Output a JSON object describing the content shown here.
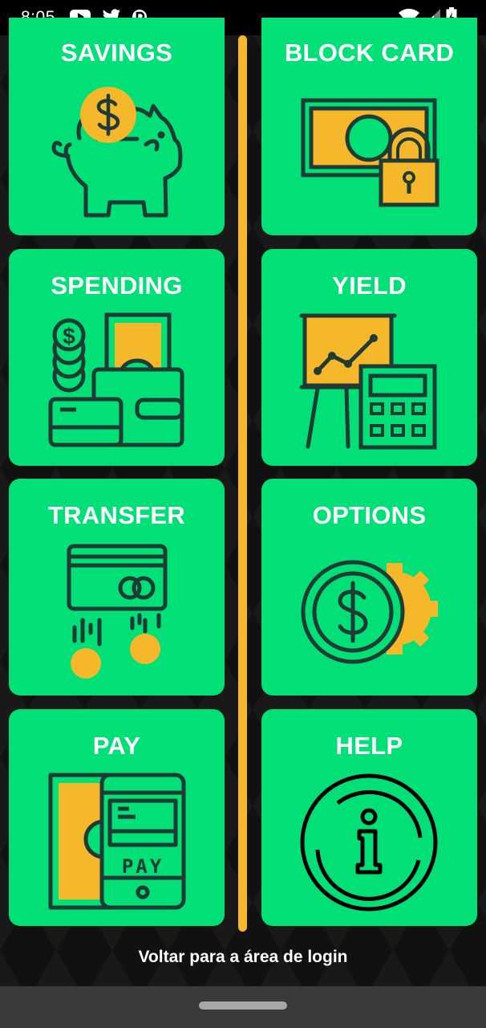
{
  "status_bar": {
    "time": "8:05",
    "icons": [
      "youtube-icon",
      "twitter-icon",
      "p-app-icon",
      "wifi-icon",
      "signal-icon",
      "battery-icon"
    ]
  },
  "colors": {
    "tile": "#00e077",
    "accent": "#f5b82a",
    "outline": "#1f3b34",
    "background": "#141414"
  },
  "tiles": {
    "savings": {
      "label": "SAVINGS",
      "icon": "piggy-bank-icon"
    },
    "block_card": {
      "label": "BLOCK CARD",
      "icon": "locked-cash-icon"
    },
    "spending": {
      "label": "SPENDING",
      "icon": "wallet-icon"
    },
    "yield": {
      "label": "YIELD",
      "icon": "chart-calculator-icon"
    },
    "transfer": {
      "label": "TRANSFER",
      "icon": "card-coins-icon"
    },
    "options": {
      "label": "OPTIONS",
      "icon": "dollar-gear-icon"
    },
    "pay": {
      "label": "PAY",
      "icon": "mobile-pay-icon"
    },
    "help": {
      "label": "HELP",
      "icon": "info-icon"
    }
  },
  "back_link": "Voltar para a área de login"
}
